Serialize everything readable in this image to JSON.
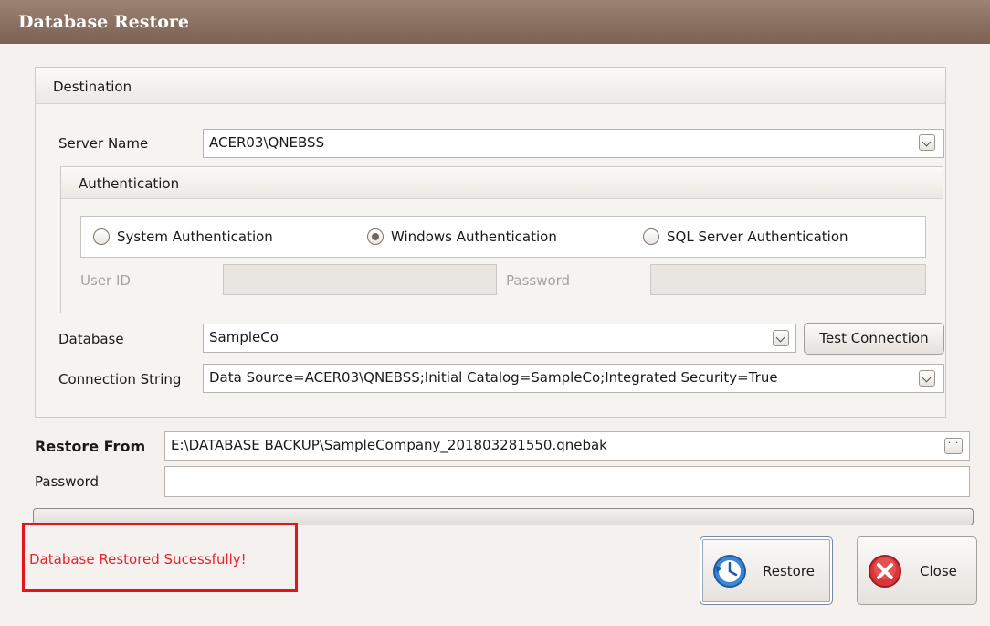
{
  "window": {
    "title": "Database Restore"
  },
  "destination": {
    "header": "Destination",
    "server_name": {
      "label": "Server Name",
      "value": "ACER03\\QNEBSS"
    },
    "authentication": {
      "header": "Authentication",
      "options": [
        {
          "label": "System Authentication",
          "selected": false
        },
        {
          "label": "Windows Authentication",
          "selected": true
        },
        {
          "label": "SQL Server Authentication",
          "selected": false
        }
      ],
      "user_id_label": "User ID",
      "password_label": "Password"
    },
    "database": {
      "label": "Database",
      "value": "SampleCo",
      "test_button": "Test Connection"
    },
    "connection_string": {
      "label": "Connection String",
      "value": "Data Source=ACER03\\QNEBSS;Initial Catalog=SampleCo;Integrated Security=True"
    }
  },
  "restore_from": {
    "label": "Restore From",
    "value": "E:\\DATABASE BACKUP\\SampleCompany_201803281550.qnebak",
    "browse": "···"
  },
  "password": {
    "label": "Password",
    "value": ""
  },
  "progress": {
    "value": 0
  },
  "status": {
    "message": "Database Restored Sucessfully!",
    "color": "#e8212e",
    "highlight_color": "#e3141b"
  },
  "buttons": {
    "restore": "Restore",
    "close": "Close"
  },
  "icons": {
    "restore": "restore-clock-icon",
    "close": "close-x-icon"
  }
}
